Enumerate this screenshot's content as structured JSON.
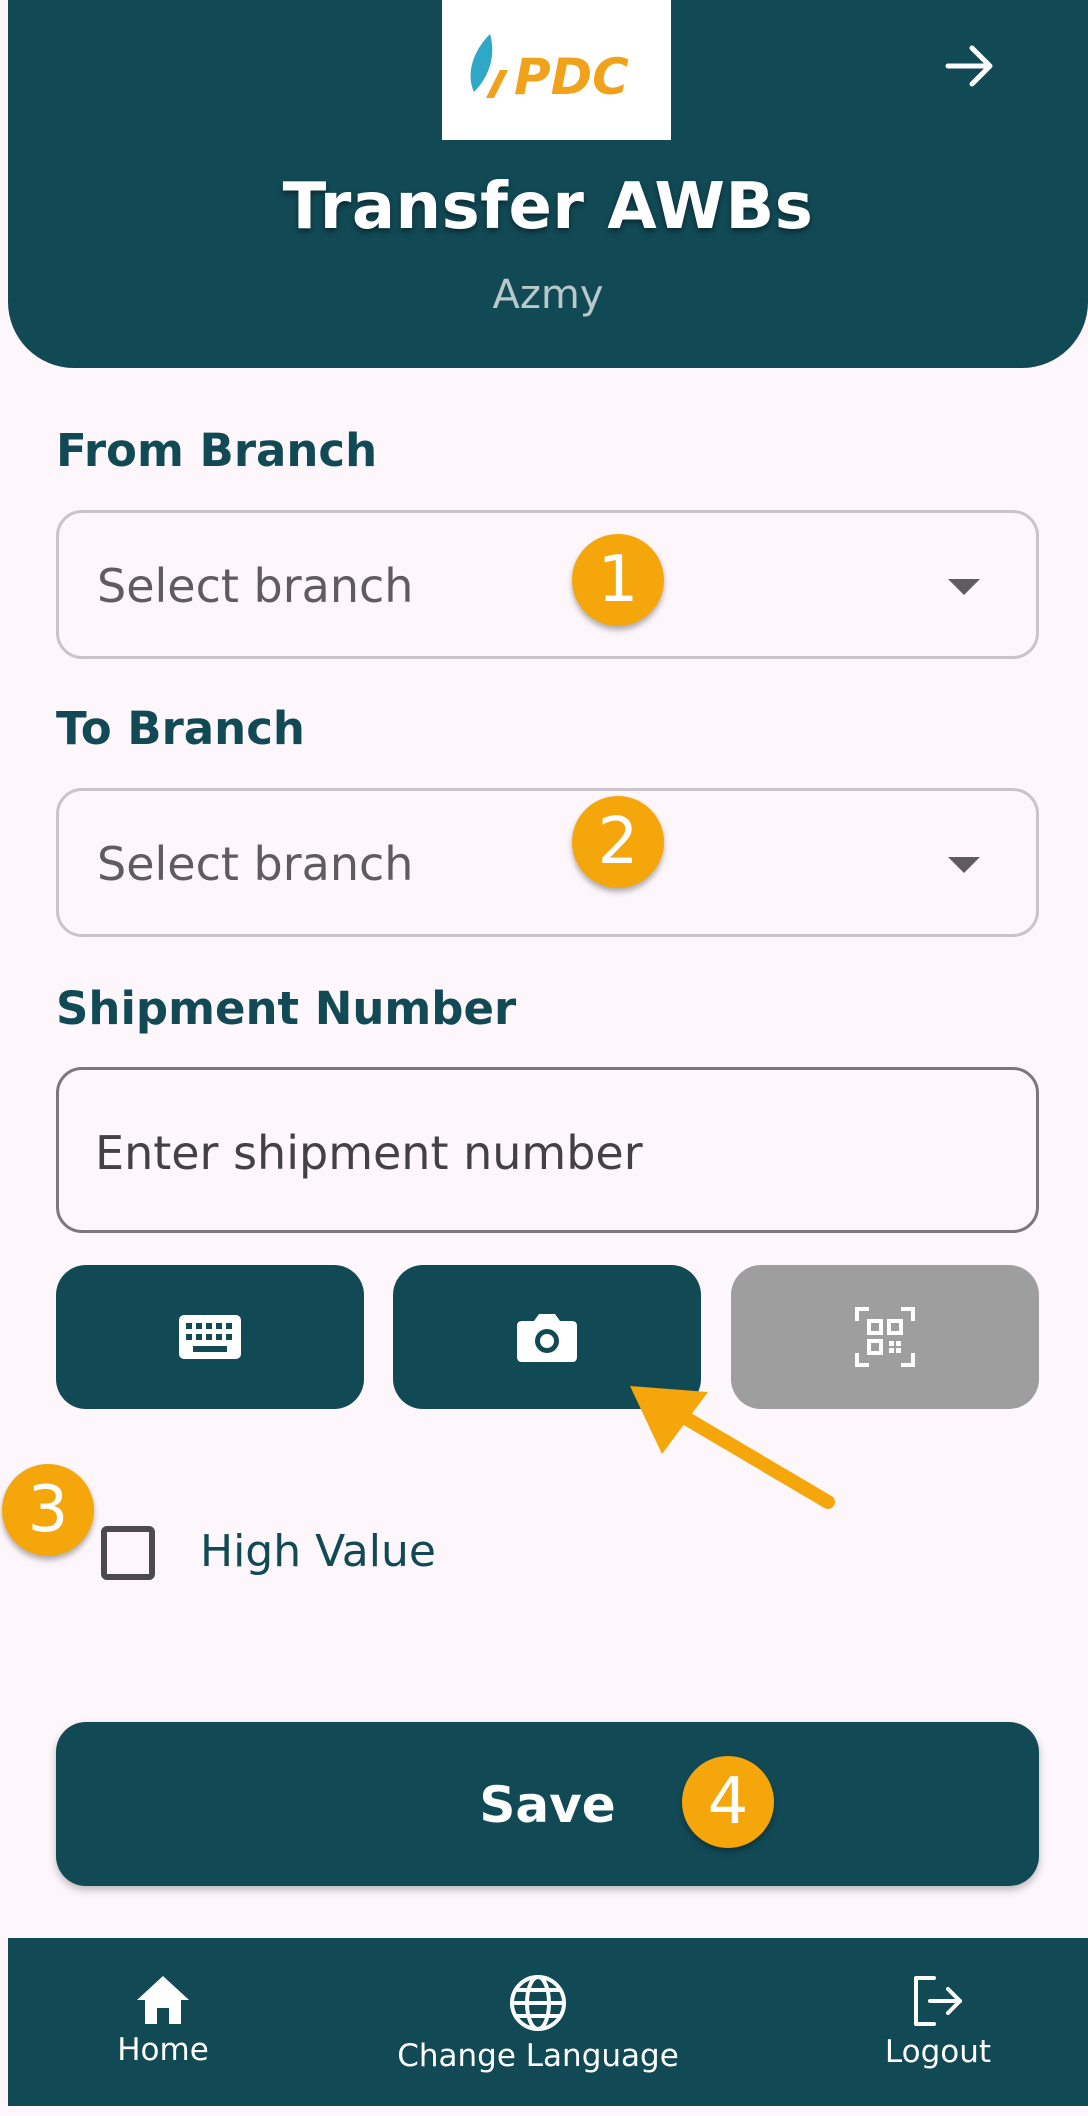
{
  "header": {
    "logo_text": "PDC",
    "title": "Transfer AWBs",
    "subtitle": "Azmy",
    "forward_icon": "arrow-right-icon"
  },
  "form": {
    "from_branch": {
      "label": "From Branch",
      "placeholder": "Select branch"
    },
    "to_branch": {
      "label": "To Branch",
      "placeholder": "Select branch"
    },
    "shipment": {
      "label": "Shipment Number",
      "placeholder": "Enter shipment number"
    },
    "input_methods": [
      {
        "name": "keyboard-icon",
        "enabled": true
      },
      {
        "name": "camera-icon",
        "enabled": true
      },
      {
        "name": "qr-scan-icon",
        "enabled": false
      }
    ],
    "high_value": {
      "label": "High Value",
      "checked": false
    },
    "save_label": "Save"
  },
  "bottom_nav": {
    "home": "Home",
    "change_language": "Change Language",
    "logout": "Logout"
  },
  "tutorial": {
    "steps": [
      "1",
      "2",
      "3",
      "4"
    ],
    "accent_color": "#f5a60a"
  },
  "colors": {
    "primary": "#114a55",
    "background": "#fdf6fb",
    "disabled": "#9e9e9e"
  }
}
